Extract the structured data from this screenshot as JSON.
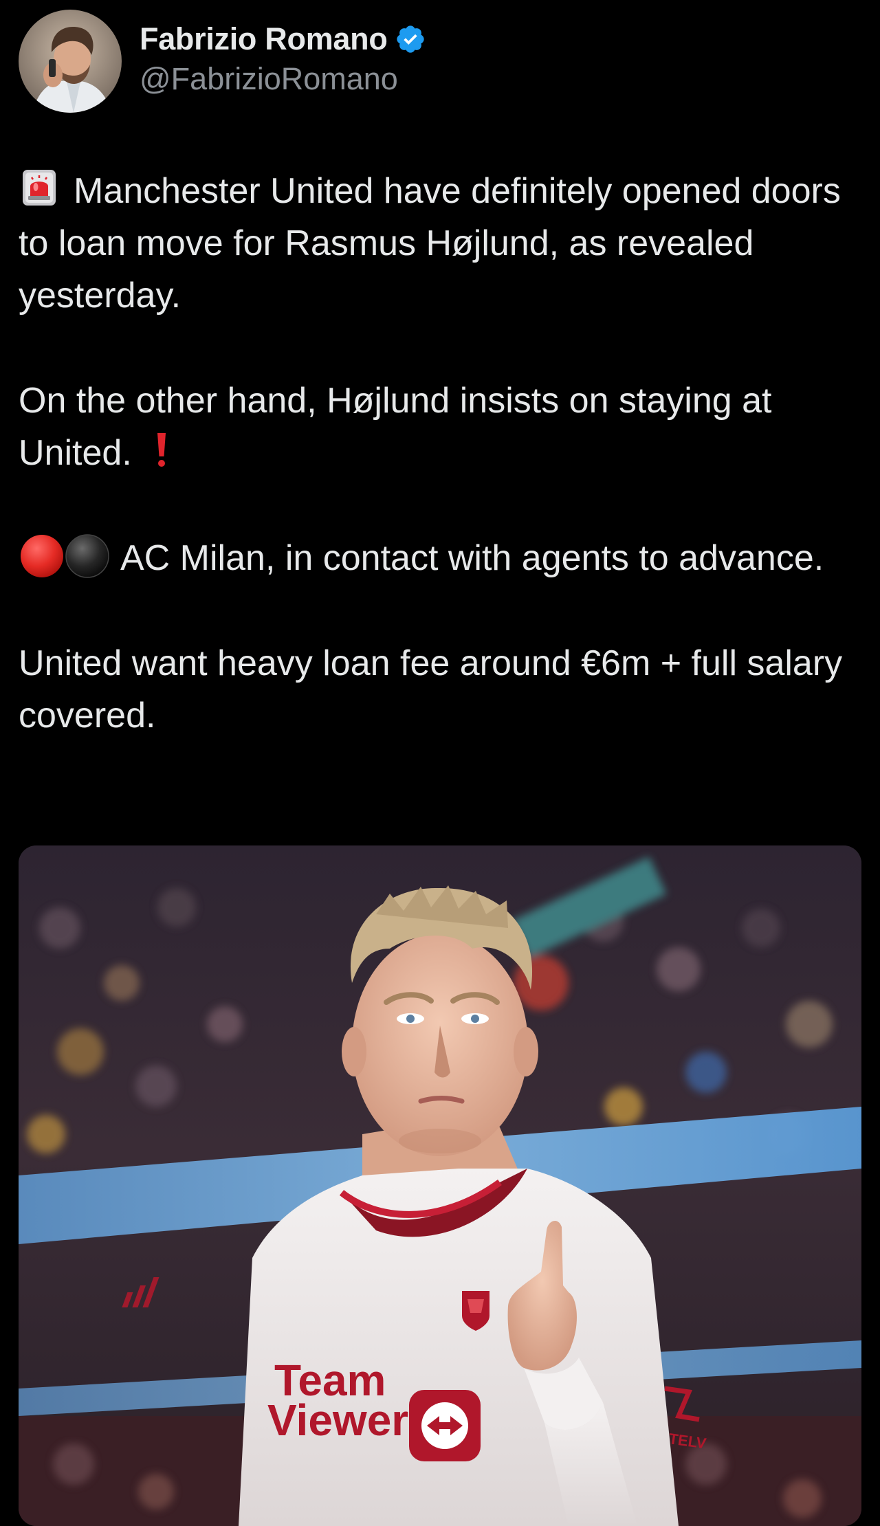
{
  "author": {
    "display_name": "Fabrizio Romano",
    "handle": "@FabrizioRomano",
    "verified": true,
    "verified_icon": "verified-badge-icon",
    "verified_color": "#1d9bf0"
  },
  "tweet": {
    "paragraphs": [
      {
        "lead_icons": [
          "rotating-light-icon"
        ],
        "text": "Manchester United have definitely opened doors to loan move for Rasmus Højlund, as revealed yesterday."
      },
      {
        "text": "On the other hand, Højlund insists on staying at United.",
        "trail_icons": [
          "red-exclamation-icon"
        ]
      },
      {
        "lead_icons": [
          "red-circle-icon",
          "black-circle-icon"
        ],
        "text": "AC Milan, in contact with agents to advance."
      },
      {
        "text": "United want heavy loan fee around €6m + full salary covered."
      }
    ]
  },
  "media": {
    "kind": "photo",
    "shirt_sponsor_line1": "Team",
    "shirt_sponsor_line2": "Viewer",
    "sleeve_sponsor": "TELV"
  },
  "colors": {
    "background": "#000000",
    "text": "#e7e9ea",
    "secondary_text": "#8b9096",
    "accent": "#1d9bf0"
  }
}
